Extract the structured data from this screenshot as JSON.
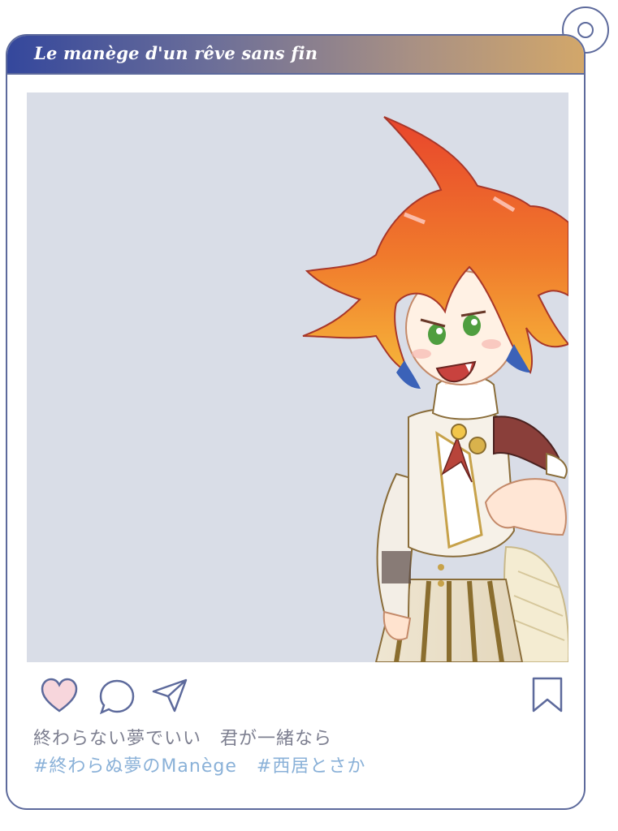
{
  "post": {
    "title": "Le manège d'un rêve sans fin",
    "caption": "終わらない夢でいい　君が一緒なら",
    "hashtags": [
      "#終わらぬ夢のManège",
      "#西居とさか"
    ]
  },
  "icons": {
    "like": "heart-icon",
    "comment": "comment-bubble-icon",
    "share": "paper-plane-icon",
    "save": "bookmark-icon",
    "tag": "ring-icon"
  },
  "colors": {
    "frame": "#5d6a9c",
    "header_gradient": [
      "#34479c",
      "#d2a76a"
    ],
    "photo_background": "#d9dde7",
    "heart_fill": "#f7d6dc",
    "caption": "#7d7f90",
    "hashtag": "#8ab1d8"
  }
}
